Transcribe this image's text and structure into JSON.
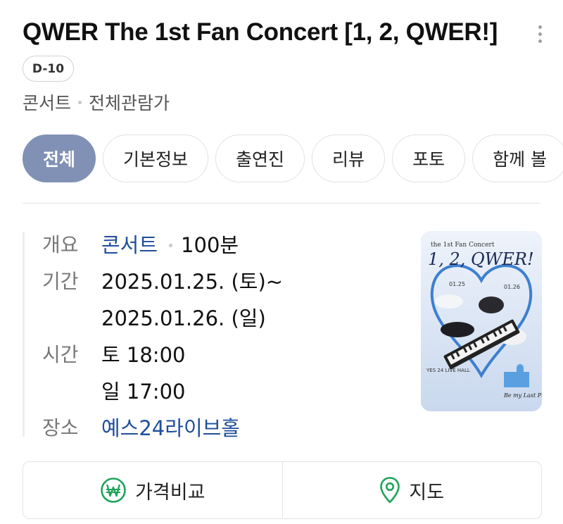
{
  "header": {
    "title": "QWER The 1st Fan Concert [1, 2, QWER!]",
    "badge": "D-10",
    "category": "콘서트",
    "rating": "전체관람가"
  },
  "tabs": [
    {
      "label": "전체",
      "active": true
    },
    {
      "label": "기본정보"
    },
    {
      "label": "출연진"
    },
    {
      "label": "리뷰"
    },
    {
      "label": "포토"
    },
    {
      "label": "함께 볼"
    }
  ],
  "info": {
    "overview_label": "개요",
    "overview_genre": "콘서트",
    "overview_runtime": "100분",
    "period_label": "기간",
    "period_start": "2025.01.25. (토)~",
    "period_end": "2025.01.26. (일)",
    "time_label": "시간",
    "time_sat": "토 18:00",
    "time_sun": "일 17:00",
    "venue_label": "장소",
    "venue": "예스24라이브홀"
  },
  "poster": {
    "title_line1": "the 1st Fan Concert",
    "title_line2": "1, 2, QWER!",
    "date1": "01.25",
    "date2": "01.26",
    "venue_text": "YES 24 LIVE HALL",
    "tagline": "Be my Last Piece"
  },
  "actions": {
    "price_compare": "가격비교",
    "map": "지도"
  },
  "colors": {
    "active_tab": "#8191b5",
    "link": "#1f4e9c",
    "action_icon": "#1fa35a"
  }
}
